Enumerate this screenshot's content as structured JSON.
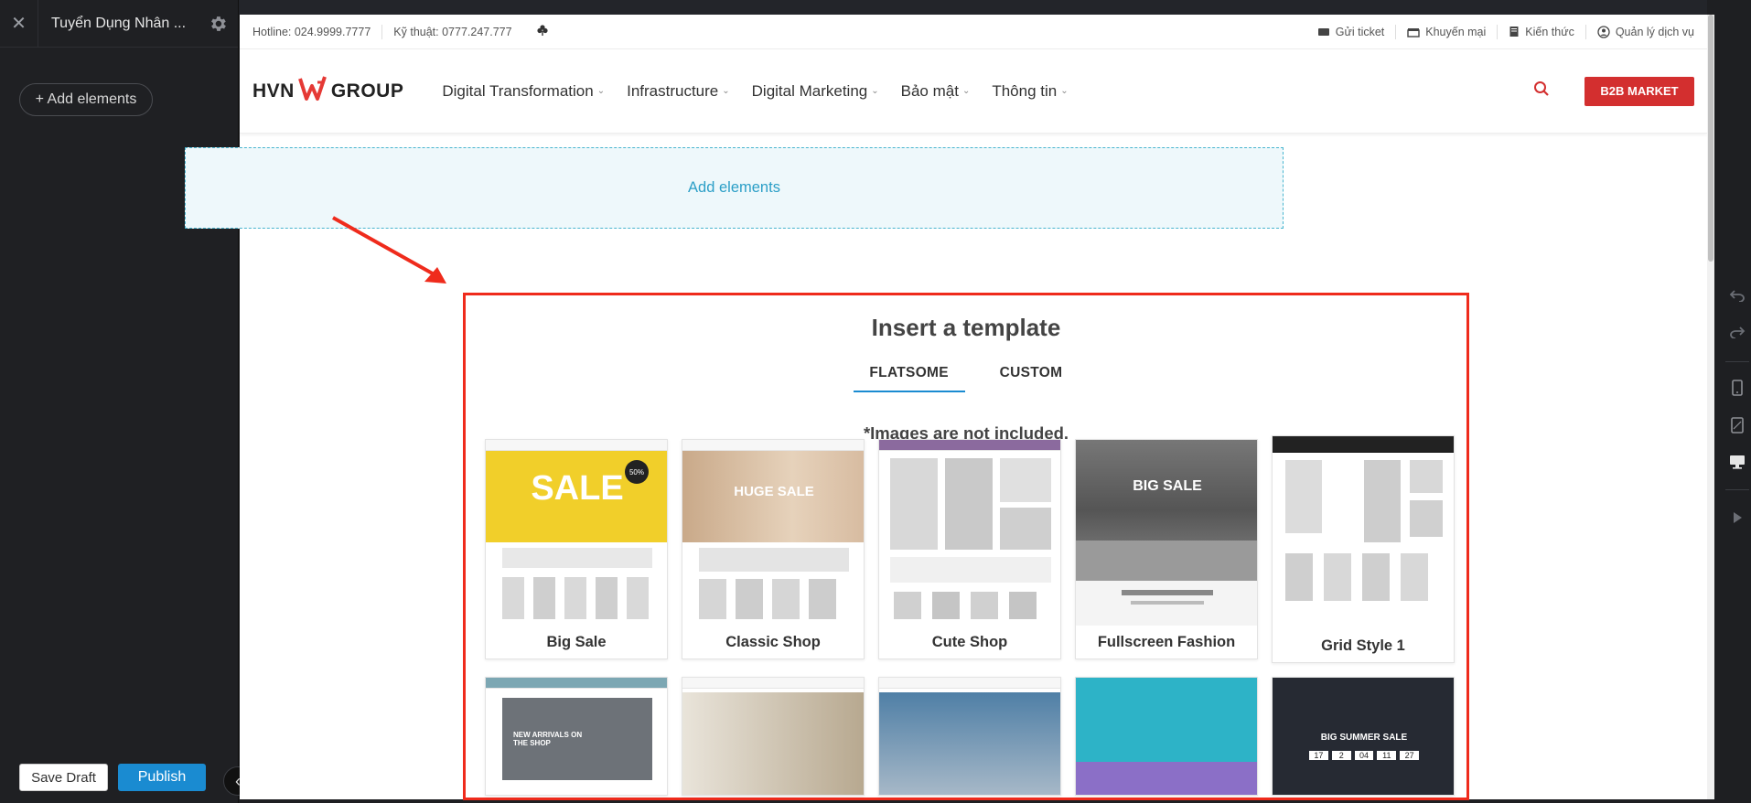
{
  "editor": {
    "page_title": "Tuyển Dụng Nhân ...",
    "add_elements_label": "+ Add elements",
    "save_draft_label": "Save Draft",
    "publish_label": "Publish"
  },
  "site": {
    "topbar": {
      "hotline": "Hotline: 024.9999.7777",
      "technical": "Kỹ thuật: 0777.247.777",
      "links": [
        "Gửi ticket",
        "Khuyến mại",
        "Kiến thức",
        "Quản lý dịch vụ"
      ]
    },
    "logo": {
      "left": "HVN",
      "right": "GROUP"
    },
    "nav": [
      "Digital Transformation",
      "Infrastructure",
      "Digital Marketing",
      "Bảo mật",
      "Thông tin"
    ],
    "cta": "B2B MARKET"
  },
  "canvas": {
    "add_elements": "Add elements"
  },
  "template_panel": {
    "title": "Insert a template",
    "tabs": [
      "FLATSOME",
      "CUSTOM"
    ],
    "note": "*Images are not included.",
    "templates": [
      "Big Sale",
      "Classic Shop",
      "Cute Shop",
      "Fullscreen Fashion",
      "Grid Style 1"
    ],
    "thumb_text": {
      "sale": "SALE",
      "sale_badge": "50%",
      "huge_sale": "HUGE SALE",
      "big_sale": "BIG SALE",
      "new_arrivals": "NEW ARRIVALS ON THE SHOP",
      "big_summer": "BIG SUMMER SALE",
      "countdown": [
        "17",
        "2",
        "04",
        "11",
        "27"
      ]
    }
  },
  "colors": {
    "accent_blue": "#1a8bd1",
    "brand_red": "#d32f2f",
    "highlight_red": "#ef2b1c",
    "drop_zone": "#49b5cf"
  }
}
